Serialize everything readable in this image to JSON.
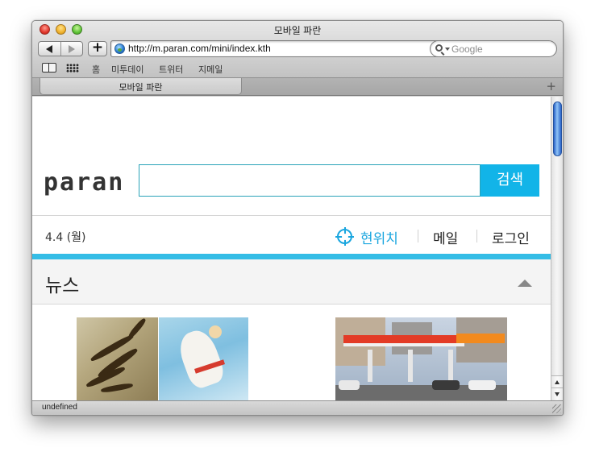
{
  "window": {
    "title": "모바일 파란"
  },
  "toolbar": {
    "back_icon": "back-arrow-icon",
    "forward_icon": "forward-arrow-icon",
    "add_label": "+",
    "url": "http://m.paran.com/mini/index.kth",
    "reload_glyph": "↻",
    "search_placeholder": "Google"
  },
  "bookmarks": {
    "items": [
      "홈",
      "미투데이",
      "트위터",
      "지메일"
    ]
  },
  "tabs": [
    {
      "label": "모바일 파란"
    }
  ],
  "tab_add_label": "+",
  "page": {
    "logo": "paran",
    "search_value": "",
    "search_button": "검색",
    "date": "4.4 (월)",
    "location_label": "현위치",
    "mail_label": "메일",
    "login_label": "로그인",
    "news_title": "뉴스",
    "accent_color": "#12b4e8"
  },
  "news_images": [
    {
      "name": "tiger-painting"
    },
    {
      "name": "angel-painting"
    },
    {
      "name": "sk-gas-station"
    }
  ],
  "status_bar": {
    "text": "undefined"
  }
}
